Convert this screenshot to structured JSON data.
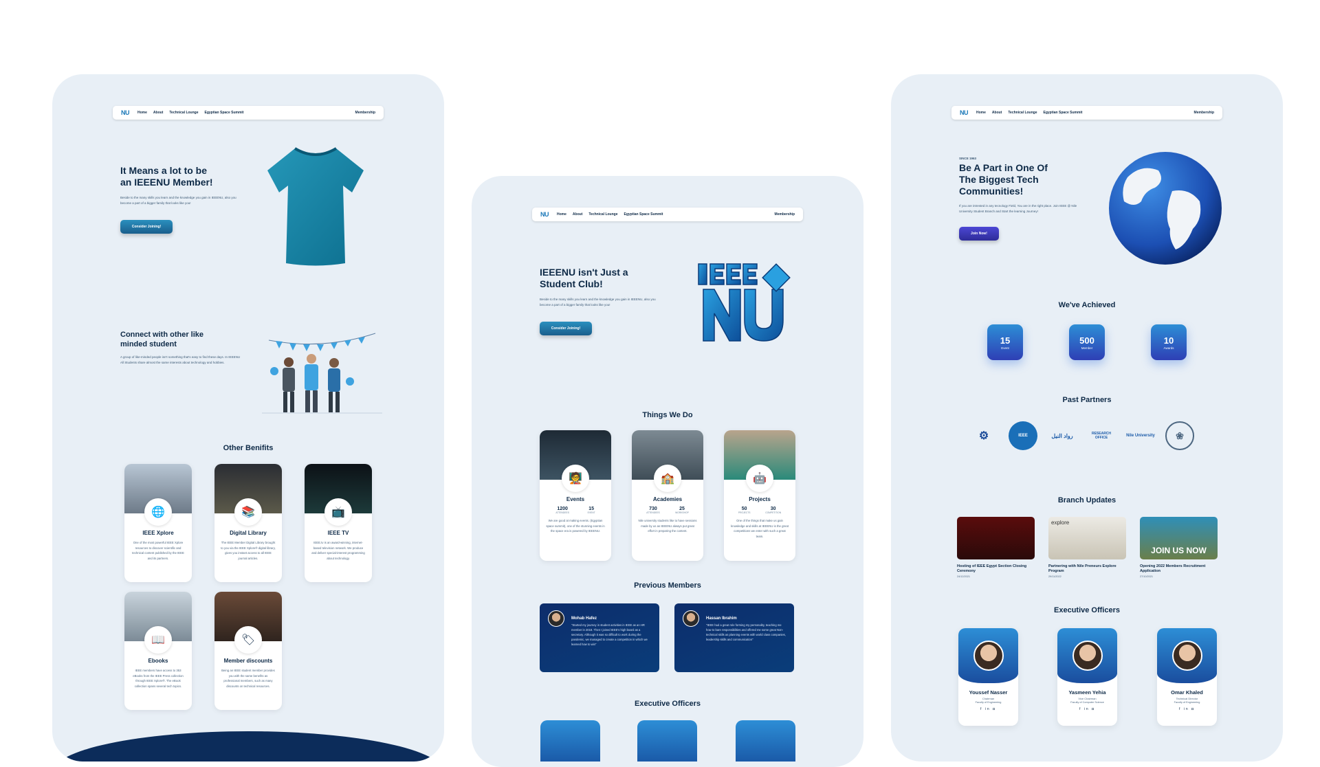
{
  "nav": {
    "logo": "NU",
    "links": [
      "Home",
      "About",
      "Technical Lounge",
      "Egyptian Space Summit"
    ],
    "membership": "Membership"
  },
  "p1": {
    "hero_title_1": "It Means a lot to be",
    "hero_title_2": "an IEEENU Member!",
    "hero_text": "Beside to the many skills you learn and the knowledge you gain in IEEENU, also you become a part of a bigger family that looks like you!",
    "hero_btn": "Consider Joining!",
    "connect_title_1": "Connect with other like",
    "connect_title_2": "minded student",
    "connect_text": "A group of like-minded people isn't something that's easy to find these days. In IEEENU All Students share almost the same interests about technology and hobbies.",
    "benefits_title": "Other Benifits",
    "benefits": [
      {
        "title": "IEEE Xplore",
        "text": "One of the most powerful IEEE Xplore resources to discover scientific and technical content published by the IEEE and its partners."
      },
      {
        "title": "Digital Library",
        "text": "The IEEE Member Digital Library brought to you via the IEEE Xplore® digital library, gives you instant access to all IEEE journal articles."
      },
      {
        "title": "IEEE TV",
        "text": "IEEE.tv is an award-winning, internet-based television network. We produce and deliver special-interest programming about technology."
      },
      {
        "title": "Ebooks",
        "text": "IEEE members have access to 353 eBooks from the IEEE Press collection through IEEE Xplore®. The eBook collection spans several tech topics."
      },
      {
        "title": "Member discounts",
        "text": "Being an IEEE student member provides you with the same benefits as professional members, such as many discounts on technical resources."
      }
    ]
  },
  "p2": {
    "hero_title_1": "IEEENU isn't Just a",
    "hero_title_2": "Student Club!",
    "hero_text": "Beside to the many skills you learn and the knowledge you gain in IEEENU, also you become a part of a bigger family that looks like you!",
    "hero_btn": "Consider Joining!",
    "things_title": "Things We Do",
    "things": [
      {
        "title": "Events",
        "stat1_val": "1200",
        "stat1_lab": "ATTENDEES",
        "stat2_val": "15",
        "stat2_lab": "EVENT",
        "text": "We are good at making events. (Egyptian space summit), one of the stunning events in the space era is powered by IEEENU."
      },
      {
        "title": "Academies",
        "stat1_val": "730",
        "stat1_lab": "ATTENDEES",
        "stat2_val": "25",
        "stat2_lab": "WORKSHOP",
        "text": "Nile university students like to have sessions made by us as IEEENU always put great effort in preparing the content."
      },
      {
        "title": "Projects",
        "stat1_val": "50",
        "stat1_lab": "PROJECTS",
        "stat2_val": "30",
        "stat2_lab": "COMPETITION",
        "text": "One of the things that make us gain knowledge and skills at IEEENU is the great competitions we enter with such a great team."
      }
    ],
    "prev_title": "Previous Members",
    "testimonials": [
      {
        "name": "Mohab Hafez",
        "text": "\"Started my journey in student activities in IEEE as an HR member in 2018. Then I joined IEEE's high board as a secretary. Although it was so difficult to work during the pandemic, we managed to create a competition in which we learned how to win\""
      },
      {
        "name": "Hassan Ibrahim",
        "text": "\"IEEE had a great role forming my personality, teaching me how to bare responsibilities and offered me some great Non-technical skills as planning events with world class companies, leadership skills and communication\""
      }
    ],
    "exec_title": "Executive Officers"
  },
  "p3": {
    "since": "SINCE 1963",
    "hero_title_1": "Be A Part in One Of",
    "hero_title_2": "The Biggest Tech",
    "hero_title_3": "Communities!",
    "hero_text": "If you are intrested in any tecnology Field, You are in the right place. Join IEEE @ Nile University Student Branch and Start the learning Journey!",
    "hero_btn": "Join Now!",
    "achieved_title": "We've Achieved",
    "stats": [
      {
        "num": "15",
        "label": "Event"
      },
      {
        "num": "500",
        "label": "Member"
      },
      {
        "num": "10",
        "label": "Awards"
      }
    ],
    "partners_title": "Past Partners",
    "partners": [
      "IEEE",
      "رواد النيل",
      "RESEARCH OFFICE",
      "Nile University"
    ],
    "updates_title": "Branch Updates",
    "updates": [
      {
        "title": "Hosting of IEEE Egypt Section Closing Ceremony",
        "date": "24/12/2021"
      },
      {
        "title": "Partnering with Nile Preneurs Explore Program",
        "date": "29/11/2022"
      },
      {
        "title": "Opening 2022 Members Recruitment Application",
        "date": "27/10/2021"
      }
    ],
    "update_img_text_2": "explore",
    "update_img_text_3": "JOIN US NOW",
    "exec_title": "Executive Officers",
    "officers": [
      {
        "name": "Youssef Nasser",
        "role": "Chairman",
        "faculty": "Faculty of Engineering"
      },
      {
        "name": "Yasmeen Yehia",
        "role": "Vice Chairman",
        "faculty": "Faculty of Computer Science"
      },
      {
        "name": "Omar Khaled",
        "role": "Technical Director",
        "faculty": "Faculty of Engineering"
      }
    ],
    "socials": "f in ◘"
  }
}
